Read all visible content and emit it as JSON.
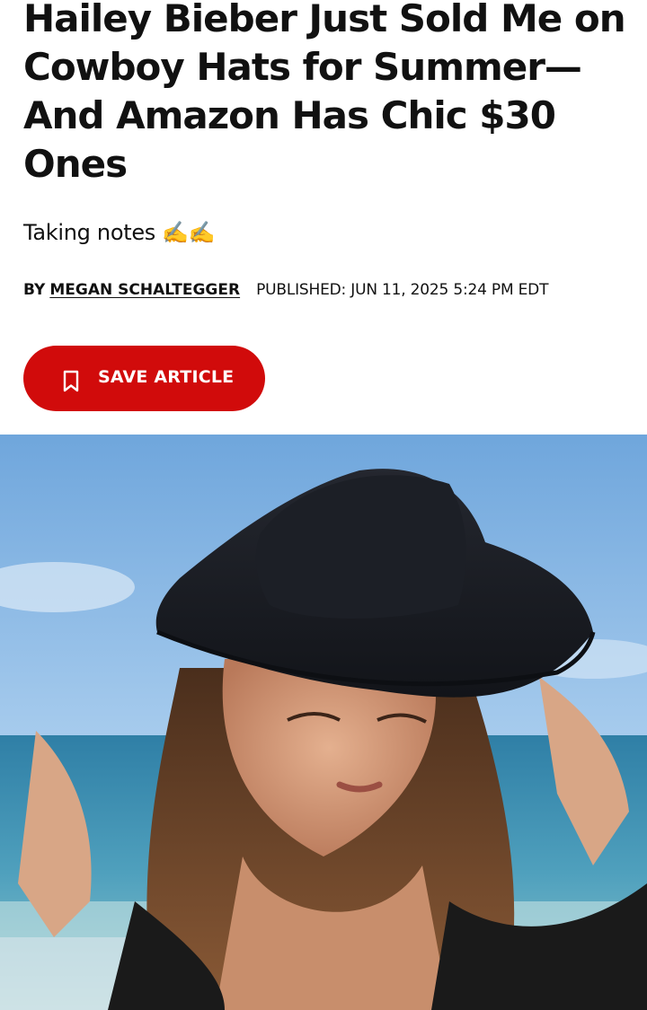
{
  "article": {
    "headline": "Hailey Bieber Just Sold Me on Cowboy Hats for Summer—And Amazon Has Chic $30 Ones",
    "dek_text": "Taking notes ",
    "dek_emoji": "✍️✍️",
    "byline": {
      "by_label": "BY",
      "author": "MEGAN SCHALTEGGER",
      "published": "PUBLISHED: JUN 11, 2025 5:24 PM EDT"
    },
    "save_button": {
      "label": "SAVE ARTICLE",
      "icon": "bookmark-icon",
      "color": "#d10b0b"
    },
    "hero_image": {
      "subject": "photo"
    }
  }
}
